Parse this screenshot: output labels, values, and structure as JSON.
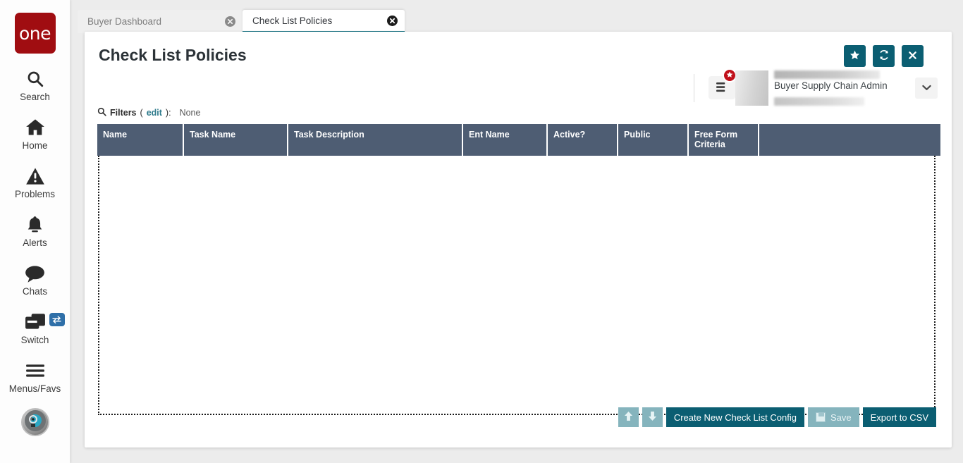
{
  "sidebar": {
    "logo_text": "one",
    "items": [
      {
        "label": "Search",
        "icon": "search-icon"
      },
      {
        "label": "Home",
        "icon": "home-icon"
      },
      {
        "label": "Problems",
        "icon": "warning-triangle-icon"
      },
      {
        "label": "Alerts",
        "icon": "bell-icon"
      },
      {
        "label": "Chats",
        "icon": "chat-bubble-icon"
      },
      {
        "label": "Switch",
        "icon": "switch-windows-icon",
        "badge_icon": "swap-arrows-icon"
      },
      {
        "label": "Menus/Favs",
        "icon": "hamburger-icon"
      }
    ],
    "avatar_icon": "profile-head-icon"
  },
  "tabs": [
    {
      "label": "Buyer Dashboard",
      "active": false,
      "close_icon": "close-circle-icon"
    },
    {
      "label": "Check List Policies",
      "active": true,
      "close_icon": "close-circle-icon"
    }
  ],
  "header": {
    "title": "Check List Policies",
    "actions": [
      {
        "name": "favorite-button",
        "icon": "star-icon"
      },
      {
        "name": "refresh-button",
        "icon": "refresh-icon"
      },
      {
        "name": "close-button",
        "icon": "x-icon"
      }
    ],
    "menu_button_icon": "hamburger-menu-icon",
    "menu_badge_icon": "star-badge-icon",
    "user_name": "Buyer Supply Chain Admin",
    "dropdown_icon": "chevron-down-icon"
  },
  "filters": {
    "icon": "search-icon",
    "label": "Filters",
    "edit_label": "edit",
    "suffix": ":",
    "value": "None"
  },
  "grid": {
    "columns": [
      "Name",
      "Task Name",
      "Task Description",
      "Ent Name",
      "Active?",
      "Public",
      "Free Form Criteria",
      ""
    ],
    "rows": []
  },
  "footer": {
    "move_up": {
      "label": "",
      "icon": "arrow-up-icon",
      "disabled": true
    },
    "move_down": {
      "label": "",
      "icon": "arrow-down-icon",
      "disabled": true
    },
    "create": {
      "label": "Create New Check List Config",
      "disabled": false
    },
    "save": {
      "label": "Save",
      "icon": "floppy-disk-icon",
      "disabled": true
    },
    "export": {
      "label": "Export to CSV",
      "disabled": false
    }
  },
  "colors": {
    "brand_red": "#a00d11",
    "teal": "#0b5e72",
    "teal_disabled": "#85b4bd",
    "grid_header": "#4e5d73",
    "link": "#2f7b8c",
    "badge_red": "#c0101a",
    "switch_badge_blue": "#2f6fa8"
  }
}
